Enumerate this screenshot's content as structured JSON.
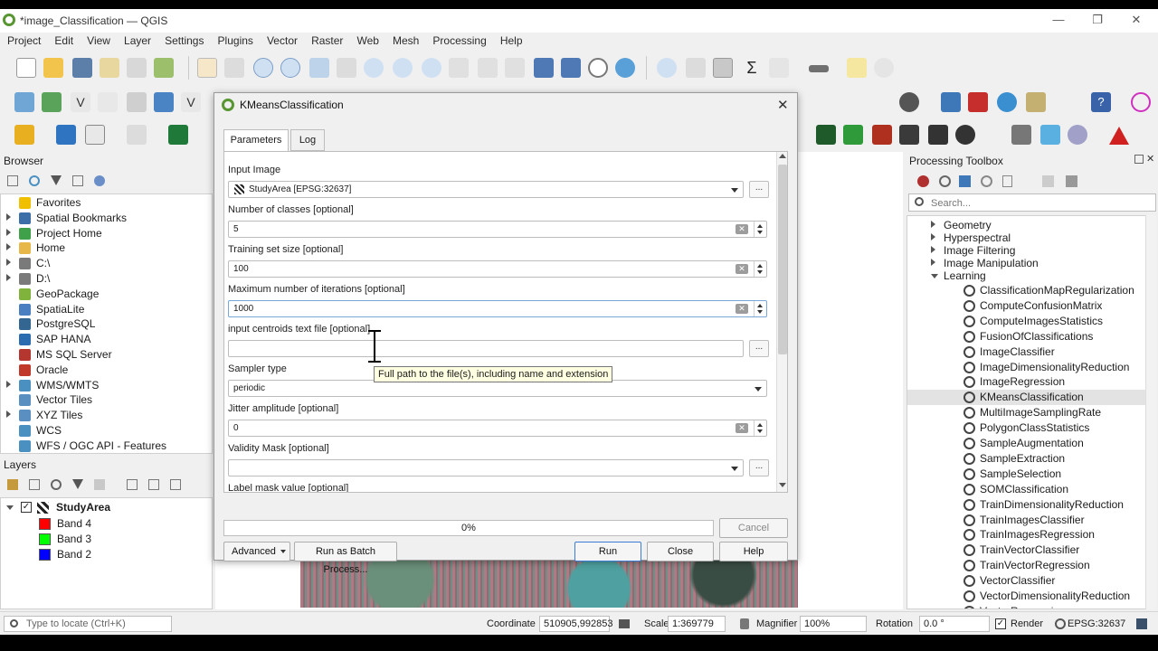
{
  "window": {
    "title": "*image_Classification — QGIS"
  },
  "menu": [
    "Project",
    "Edit",
    "View",
    "Layer",
    "Settings",
    "Plugins",
    "Vector",
    "Raster",
    "Web",
    "Mesh",
    "Processing",
    "Help"
  ],
  "browser": {
    "title": "Browser",
    "items": [
      {
        "label": "Favorites",
        "icon": "star-icon",
        "color": "#f0c000",
        "expand": false
      },
      {
        "label": "Spatial Bookmarks",
        "icon": "bookmark-icon",
        "color": "#3c6ea8",
        "expand": true
      },
      {
        "label": "Project Home",
        "icon": "folder-icon",
        "color": "#3fa14a",
        "expand": true
      },
      {
        "label": "Home",
        "icon": "folder-icon",
        "color": "#e8b74a",
        "expand": true
      },
      {
        "label": "C:\\",
        "icon": "drive-icon",
        "color": "#7a7a7a",
        "expand": true
      },
      {
        "label": "D:\\",
        "icon": "drive-icon",
        "color": "#7a7a7a",
        "expand": true
      },
      {
        "label": "GeoPackage",
        "icon": "geopackage-icon",
        "color": "#7fb33b",
        "expand": false
      },
      {
        "label": "SpatiaLite",
        "icon": "spatialite-icon",
        "color": "#4a7fc1",
        "expand": false
      },
      {
        "label": "PostgreSQL",
        "icon": "postgres-icon",
        "color": "#336791",
        "expand": false
      },
      {
        "label": "SAP HANA",
        "icon": "hana-icon",
        "color": "#2b6cb0",
        "expand": false
      },
      {
        "label": "MS SQL Server",
        "icon": "mssql-icon",
        "color": "#b5362f",
        "expand": false
      },
      {
        "label": "Oracle",
        "icon": "oracle-icon",
        "color": "#c0392b",
        "expand": false
      },
      {
        "label": "WMS/WMTS",
        "icon": "globe-icon",
        "color": "#4a90c0",
        "expand": true
      },
      {
        "label": "Vector Tiles",
        "icon": "grid-icon",
        "color": "#5a8fc2",
        "expand": false
      },
      {
        "label": "XYZ Tiles",
        "icon": "grid-icon",
        "color": "#5a8fc2",
        "expand": true
      },
      {
        "label": "WCS",
        "icon": "globe-icon",
        "color": "#4a90c0",
        "expand": false
      },
      {
        "label": "WFS / OGC API - Features",
        "icon": "globe-icon",
        "color": "#4a90c0",
        "expand": false
      }
    ]
  },
  "layers": {
    "title": "Layers",
    "layer": "StudyArea",
    "bands": [
      {
        "label": "Band 4",
        "color": "#ff0000"
      },
      {
        "label": "Band 3",
        "color": "#00ff00"
      },
      {
        "label": "Band 2",
        "color": "#0000ff"
      }
    ]
  },
  "dialog": {
    "title": "KMeansClassification",
    "tabs": [
      "Parameters",
      "Log"
    ],
    "fields": {
      "input_image_label": "Input Image",
      "input_image_value": "StudyArea [EPSG:32637]",
      "classes_label": "Number of classes [optional]",
      "classes_value": "5",
      "training_label": "Training set size [optional]",
      "training_value": "100",
      "iterations_label": "Maximum number of iterations [optional]",
      "iterations_value": "1000",
      "centroids_label": "input centroids text file [optional]",
      "centroids_value": "",
      "sampler_label": "Sampler type",
      "sampler_value": "periodic",
      "jitter_label": "Jitter amplitude [optional]",
      "jitter_value": "0",
      "mask_label": "Validity Mask [optional]",
      "mask_value": "",
      "label_mask_label": "Label mask value [optional]"
    },
    "tooltip": "Full path to the file(s), including name and extension",
    "progress_percent": 0,
    "progress_text": "0%",
    "buttons": {
      "cancel": "Cancel",
      "advanced": "Advanced",
      "batch": "Run as Batch Process...",
      "run": "Run",
      "close": "Close",
      "help": "Help"
    }
  },
  "toolbox": {
    "title": "Processing Toolbox",
    "search_placeholder": "Search...",
    "groups": [
      "Geometry",
      "Hyperspectral",
      "Image Filtering",
      "Image Manipulation",
      "Learning"
    ],
    "algorithms": [
      "ClassificationMapRegularization",
      "ComputeConfusionMatrix",
      "ComputeImagesStatistics",
      "FusionOfClassifications",
      "ImageClassifier",
      "ImageDimensionalityReduction",
      "ImageRegression",
      "KMeansClassification",
      "MultiImageSamplingRate",
      "PolygonClassStatistics",
      "SampleAugmentation",
      "SampleExtraction",
      "SampleSelection",
      "SOMClassification",
      "TrainDimensionalityReduction",
      "TrainImagesClassifier",
      "TrainImagesRegression",
      "TrainVectorClassifier",
      "TrainVectorRegression",
      "VectorClassifier",
      "VectorDimensionalityReduction",
      "VectorRegression"
    ],
    "selected": "KMeansClassification"
  },
  "status": {
    "locate_placeholder": "Type to locate (Ctrl+K)",
    "coordinate_label": "Coordinate",
    "coordinate_value": "510905,992853",
    "scale_label": "Scale",
    "scale_value": "1:369779",
    "magnifier_label": "Magnifier",
    "magnifier_value": "100%",
    "rotation_label": "Rotation",
    "rotation_value": "0.0 °",
    "render_label": "Render",
    "crs_value": "EPSG:32637"
  }
}
